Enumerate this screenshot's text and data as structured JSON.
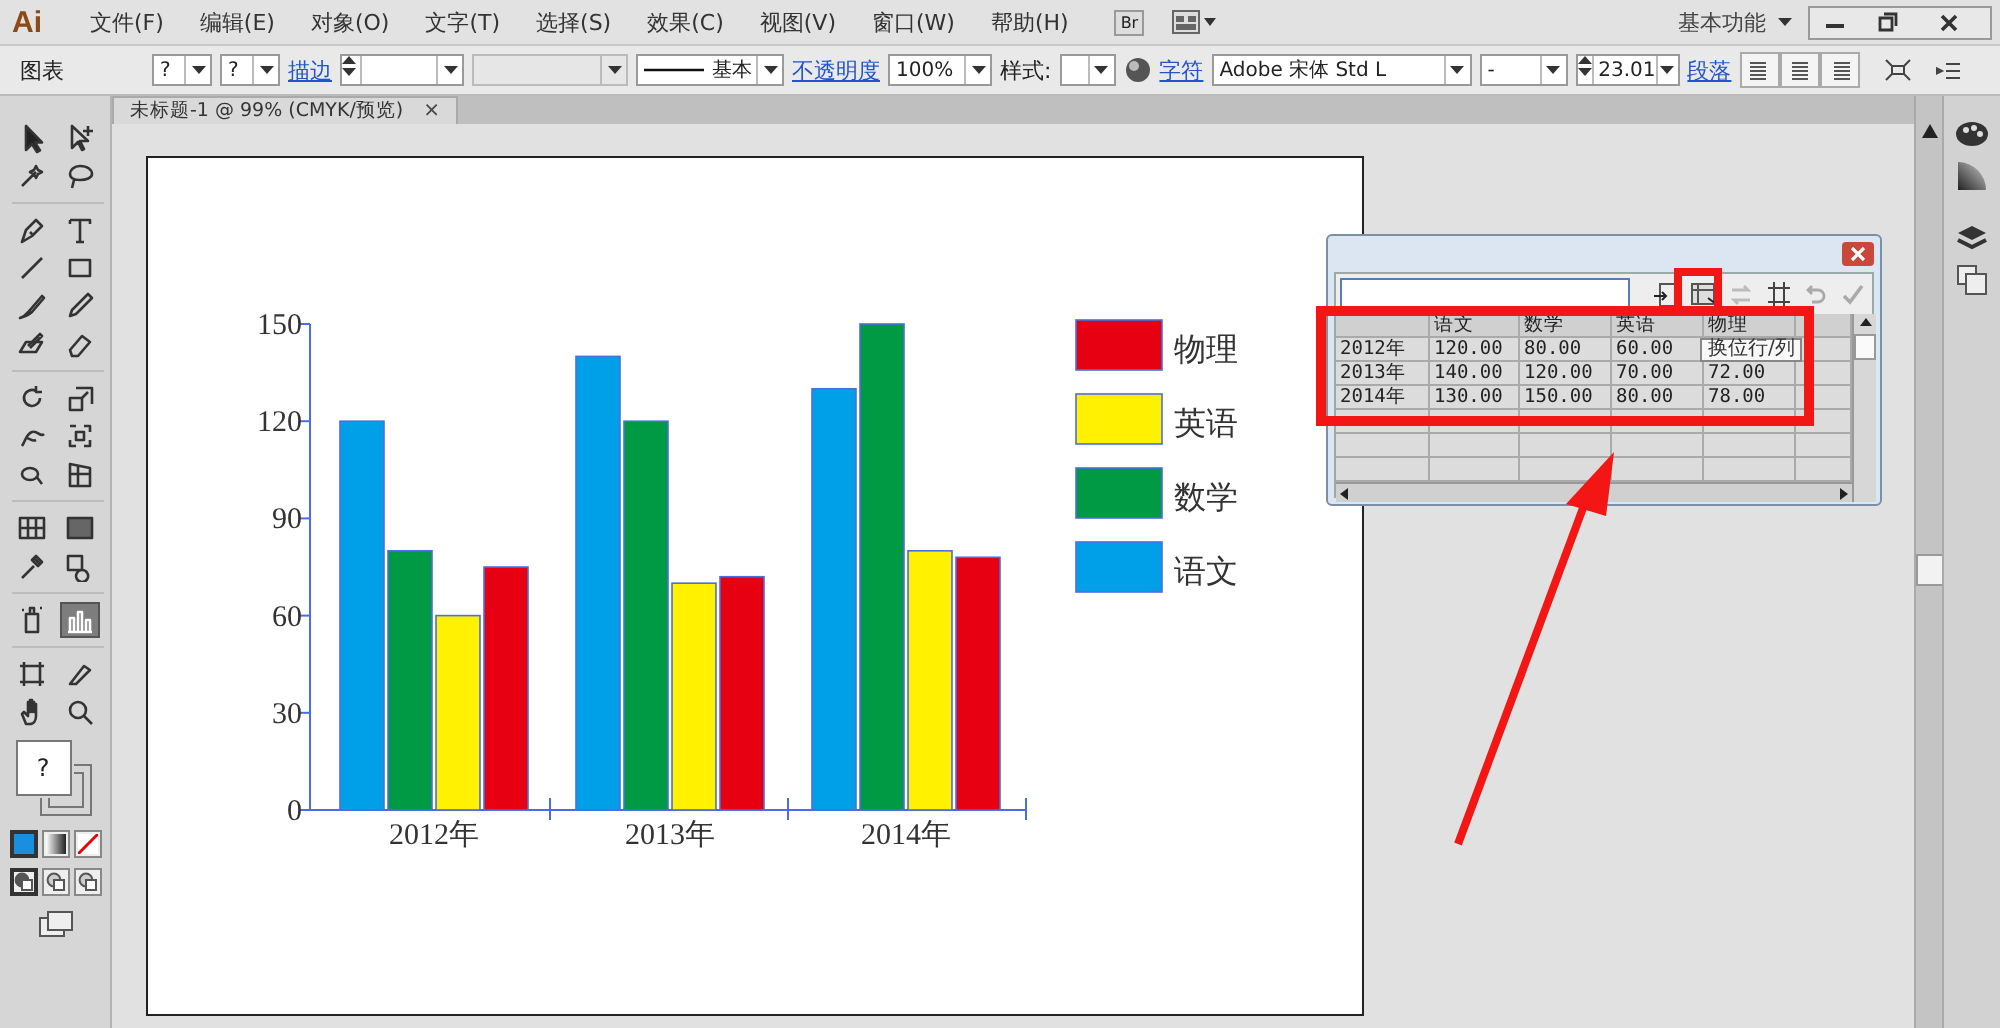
{
  "app": {
    "logo": "Ai",
    "menus": [
      "文件(F)",
      "编辑(E)",
      "对象(O)",
      "文字(T)",
      "选择(S)",
      "效果(C)",
      "视图(V)",
      "窗口(W)",
      "帮助(H)"
    ],
    "bridge_button": "Br",
    "workspace": "基本功能"
  },
  "control_bar": {
    "title": "图表",
    "fill": "?",
    "stroke_swatch": "?",
    "stroke_label": "描边",
    "stroke_profile": "基本",
    "opacity_label": "不透明度",
    "opacity": "100%",
    "style_label": "样式:",
    "character_label": "字符",
    "font": "Adobe 宋体 Std L",
    "font_style": "-",
    "font_size": "23.01",
    "paragraph_label": "段落"
  },
  "document_tab": {
    "title": "未标题-1 @ 99% (CMYK/预览)",
    "close": "×"
  },
  "tools": [
    {
      "selected": false
    },
    {
      "selected": false
    },
    {
      "selected": false
    },
    {
      "selected": false
    },
    {
      "selected": false
    },
    {
      "selected": false
    },
    {
      "selected": false
    },
    {
      "selected": false
    },
    {
      "selected": false
    },
    {
      "selected": false
    },
    {
      "selected": false
    },
    {
      "selected": false
    },
    {
      "selected": false
    },
    {
      "selected": false
    },
    {
      "selected": false
    },
    {
      "selected": false
    },
    {
      "selected": false
    },
    {
      "selected": false
    },
    {
      "selected": false
    },
    {
      "selected": false
    },
    {
      "selected": false
    },
    {
      "selected": false
    },
    {
      "selected": false
    },
    {
      "selected": true
    },
    {
      "selected": false
    },
    {
      "selected": false
    },
    {
      "selected": false
    },
    {
      "selected": false
    }
  ],
  "fill_stroke": {
    "fill": "?"
  },
  "color_modes": [
    {
      "selected": true
    },
    {
      "selected": false
    },
    {
      "selected": false
    }
  ],
  "draw_modes": [
    {
      "selected": true
    },
    {
      "selected": false
    },
    {
      "selected": false
    }
  ],
  "artboard": {
    "chart_data": {
      "type": "bar",
      "legend": true,
      "categories": [
        "2012年",
        "2013年",
        "2014年"
      ],
      "ylim": [
        0,
        150
      ],
      "yticks": [
        0,
        30,
        60,
        90,
        120,
        150
      ],
      "series": [
        {
          "name": "语文",
          "color": "#00a0e9",
          "values": [
            120,
            140,
            130
          ]
        },
        {
          "name": "数学",
          "color": "#009944",
          "values": [
            80,
            120,
            150
          ]
        },
        {
          "name": "英语",
          "color": "#fff100",
          "values": [
            60,
            70,
            80
          ]
        },
        {
          "name": "物理",
          "color": "#e60012",
          "values": [
            75,
            72,
            78
          ]
        }
      ]
    }
  },
  "graph_data_window": {
    "tooltip": "换位行/列",
    "columns": [
      "语文",
      "数学",
      "英语",
      "物理"
    ],
    "rows": [
      {
        "label": "2012年",
        "cells": [
          "120.00",
          "80.00",
          "60.00"
        ]
      },
      {
        "label": "2013年",
        "cells": [
          "140.00",
          "120.00",
          "70.00",
          "72.00"
        ]
      },
      {
        "label": "2014年",
        "cells": [
          "130.00",
          "150.00",
          "80.00",
          "78.00"
        ]
      }
    ]
  }
}
